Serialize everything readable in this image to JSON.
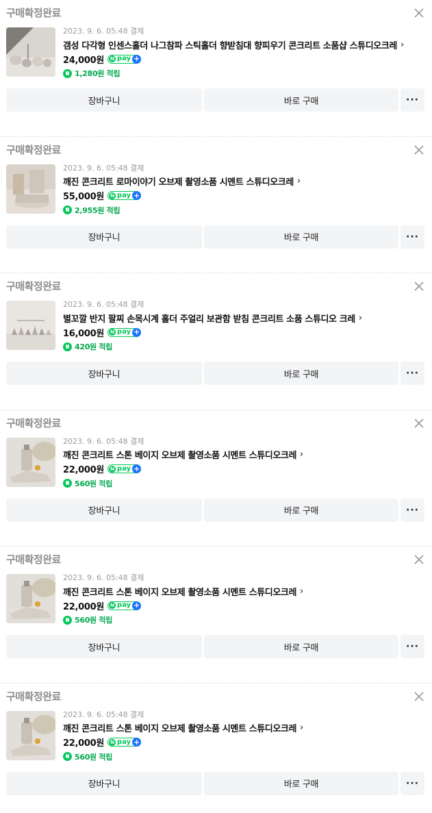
{
  "orders": [
    {
      "status": "구매확정완료",
      "date": "2023. 9. 6. 05:48 결제",
      "title": "갬성 다각형 인센스홀더 나그참파 스틱홀더 향받침대 향피우기 콘크리트 소품샵 스튜디오크레",
      "price": "24,000원",
      "npay_label": "pay",
      "points": "1,280원 적립",
      "cart_label": "장바구니",
      "buy_label": "바로 구매",
      "more_label": "···",
      "thumb": "incense-holder"
    },
    {
      "status": "구매확정완료",
      "date": "2023. 9. 6. 05:48 결제",
      "title": "깨진 콘크리트 로마이야기 오브제 촬영소품 시멘트 스튜디오크레",
      "price": "55,000원",
      "npay_label": "pay",
      "points": "2,955원 적립",
      "cart_label": "장바구니",
      "buy_label": "바로 구매",
      "more_label": "···",
      "thumb": "concrete-rome"
    },
    {
      "status": "구매확정완료",
      "date": "2023. 9. 6. 05:48 결제",
      "title": "별꼬깔 반지 팔찌 손목시계 홀더 주얼리 보관함 받침 콘크리트 소품 스튜디오 크레",
      "price": "16,000원",
      "npay_label": "pay",
      "points": "420원 적립",
      "cart_label": "장바구니",
      "buy_label": "바로 구매",
      "more_label": "···",
      "thumb": "jewelry-holder"
    },
    {
      "status": "구매확정완료",
      "date": "2023. 9. 6. 05:48 결제",
      "title": "깨진 콘크리트 스톤 베이지 오브제 촬영소품 시멘트 스튜디오크레",
      "price": "22,000원",
      "npay_label": "pay",
      "points": "560원 적립",
      "cart_label": "장바구니",
      "buy_label": "바로 구매",
      "more_label": "···",
      "thumb": "stone-beige"
    },
    {
      "status": "구매확정완료",
      "date": "2023. 9. 6. 05:48 결제",
      "title": "깨진 콘크리트 스톤 베이지 오브제 촬영소품 시멘트 스튜디오크레",
      "price": "22,000원",
      "npay_label": "pay",
      "points": "560원 적립",
      "cart_label": "장바구니",
      "buy_label": "바로 구매",
      "more_label": "···",
      "thumb": "stone-beige"
    },
    {
      "status": "구매확정완료",
      "date": "2023. 9. 6. 05:48 결제",
      "title": "깨진 콘크리트 스톤 베이지 오브제 촬영소품 시멘트 스튜디오크레",
      "price": "22,000원",
      "npay_label": "pay",
      "points": "560원 적립",
      "cart_label": "장바구니",
      "buy_label": "바로 구매",
      "more_label": "···",
      "thumb": "stone-beige"
    }
  ],
  "colors": {
    "accent_green": "#03c75a",
    "npay_plus_blue": "#1e74ff",
    "status_gray": "#8e8e8e"
  }
}
